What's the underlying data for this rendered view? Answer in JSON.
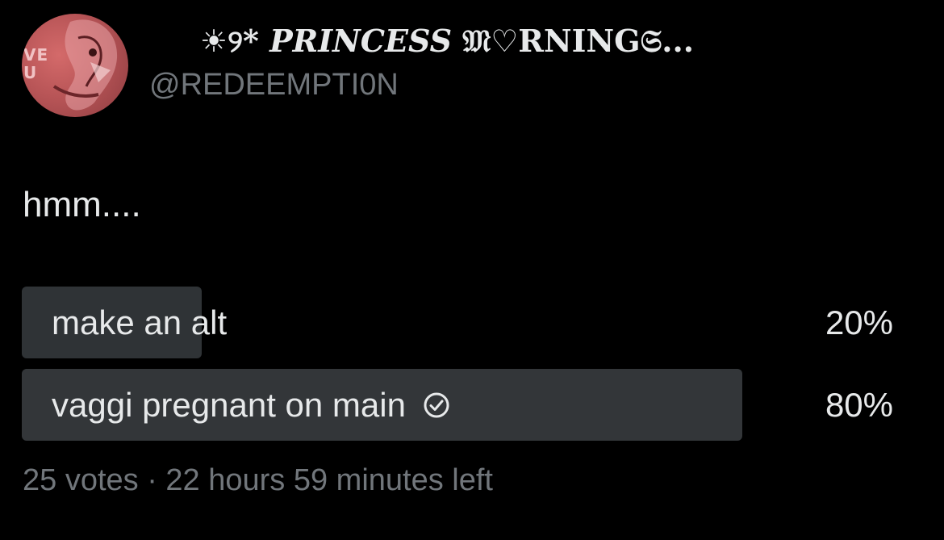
{
  "author": {
    "display_name_prefix": "☀︎୨*",
    "display_name_italic": "PRINCESS",
    "display_name_rest": "𝔐♡RNING𝔖...",
    "handle": "@REDEEMPTI0N",
    "avatar_text": "VE\nU"
  },
  "tweet": {
    "text": "hmm...."
  },
  "poll": {
    "options": [
      {
        "label": "make an alt",
        "percent": "20%",
        "percent_value": 20,
        "selected": false
      },
      {
        "label": "vaggi pregnant on main",
        "percent": "80%",
        "percent_value": 80,
        "selected": true
      }
    ],
    "footer": "25 votes · 22 hours 59 minutes left"
  },
  "colors": {
    "background": "#000000",
    "text_primary": "#e7e9ea",
    "text_secondary": "#71767b",
    "poll_bar": "#333639",
    "avatar": "#b85557"
  },
  "icons": {
    "selected_option": "check-circle-icon"
  }
}
